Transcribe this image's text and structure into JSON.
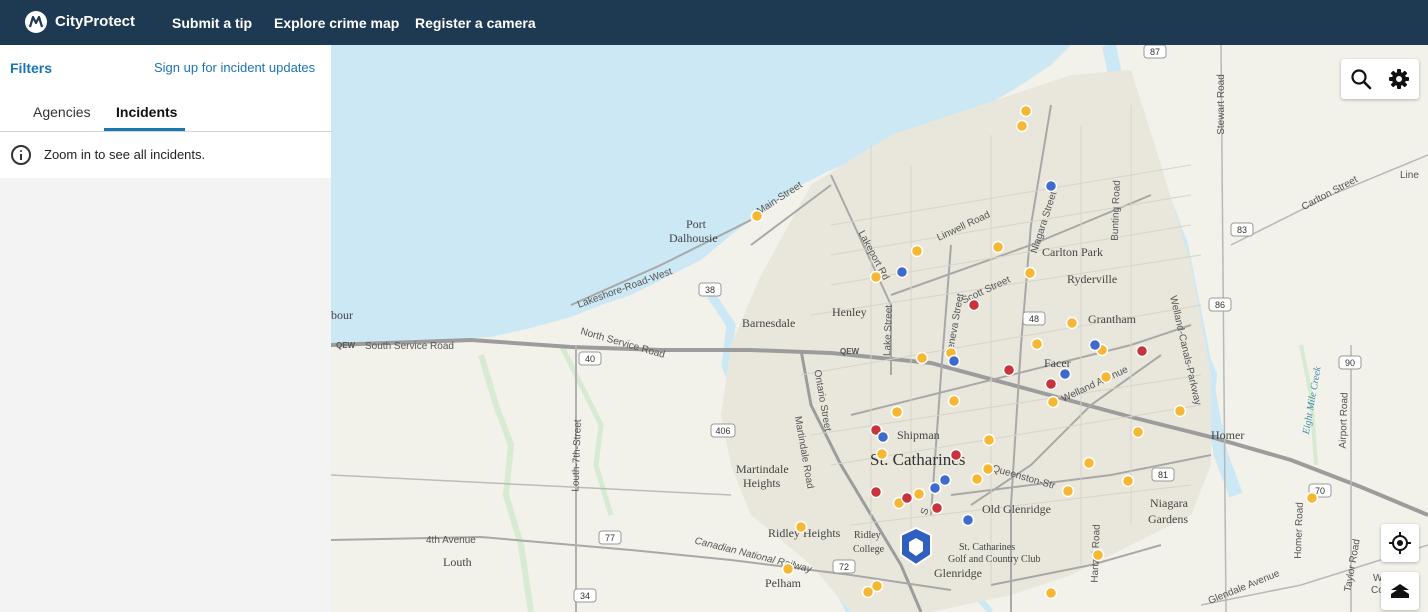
{
  "header": {
    "brand": "CityProtect",
    "nav": [
      "Submit a tip",
      "Explore crime map",
      "Register a camera"
    ]
  },
  "panel": {
    "filters_label": "Filters",
    "signup_label": "Sign up for incident updates",
    "tabs": [
      {
        "label": "Agencies",
        "active": false
      },
      {
        "label": "Incidents",
        "active": true
      }
    ],
    "info_text": "Zoom in to see all incidents."
  },
  "map": {
    "places": {
      "st_catharines": "St. Catharines",
      "port_dalhousie": [
        "Port",
        "Dalhousie"
      ],
      "barnesdale": "Barnesdale",
      "henley": "Henley",
      "carlton_park": "Carlton Park",
      "ryderville": "Ryderville",
      "grantham": "Grantham",
      "facer": "Facer",
      "shipman": "Shipman",
      "martindale_heights": [
        "Martindale",
        "Heights"
      ],
      "old_glenridge": "Old Glenridge",
      "ridley_heights": "Ridley Heights",
      "ridley_college": [
        "Ridley",
        "College"
      ],
      "glenridge": "Glenridge",
      "golf_club": [
        "St. Catharines",
        "Golf and Country Club"
      ],
      "pelham": "Pelham",
      "louth": "Louth",
      "homer": "Homer",
      "niagara_gardens": [
        "Niagara",
        "Gardens"
      ],
      "harbour_partial": "bour",
      "line_partial": "Line",
      "conse_partial": "Conse",
      "w_partial": "W"
    },
    "roads": {
      "main_street": "Main-Street",
      "lakeshore_west": "Lakeshore-Road-West",
      "south_service": "South Service Road",
      "north_service": "North Service Road",
      "qew_label": "QEW",
      "lakeport": "Lakeport Rd",
      "linwell": "Linwell Road",
      "niagara_street": "Niagara Street",
      "bunting": "Bunting Road",
      "scott": "Scott Street",
      "geneva": "Geneva Street",
      "lake_street": "Lake Street",
      "ontario": "Ontario Street",
      "martindale": "Martindale Road",
      "welland_ave": "Welland Avenue",
      "queenston": "Queenston-Str",
      "welland_canals": "Welland-Canals-Parkway",
      "stewart": "Stewart Road",
      "carlton": "Carlton Street",
      "airport": "Airport Road",
      "homer_road": "Homer Road",
      "taylor": "Taylor Road",
      "glendale": "Glendale Avenue",
      "hartzel": "Hartzel Road",
      "louth_7th": "Louth-7th-Street",
      "fourth_avenue": "4th Avenue",
      "cnr": "Canadian National Railway",
      "eight_mile": "Eight Mile Creek",
      "south_street_partial": "S"
    },
    "shields": [
      "87",
      "83",
      "86",
      "90",
      "81",
      "70",
      "48",
      "38",
      "40",
      "406",
      "77",
      "72",
      "34"
    ],
    "colors": {
      "water": "#cce8f4",
      "land": "#f2f1ea",
      "orange": "#f6b733",
      "red": "#c9343c",
      "blue": "#3f6ccc",
      "topbar": "#1e3a52",
      "link": "#1a75b4"
    },
    "icons": [
      "search-icon",
      "gear-icon",
      "locate-icon",
      "layers-icon",
      "police-badge-icon"
    ]
  }
}
